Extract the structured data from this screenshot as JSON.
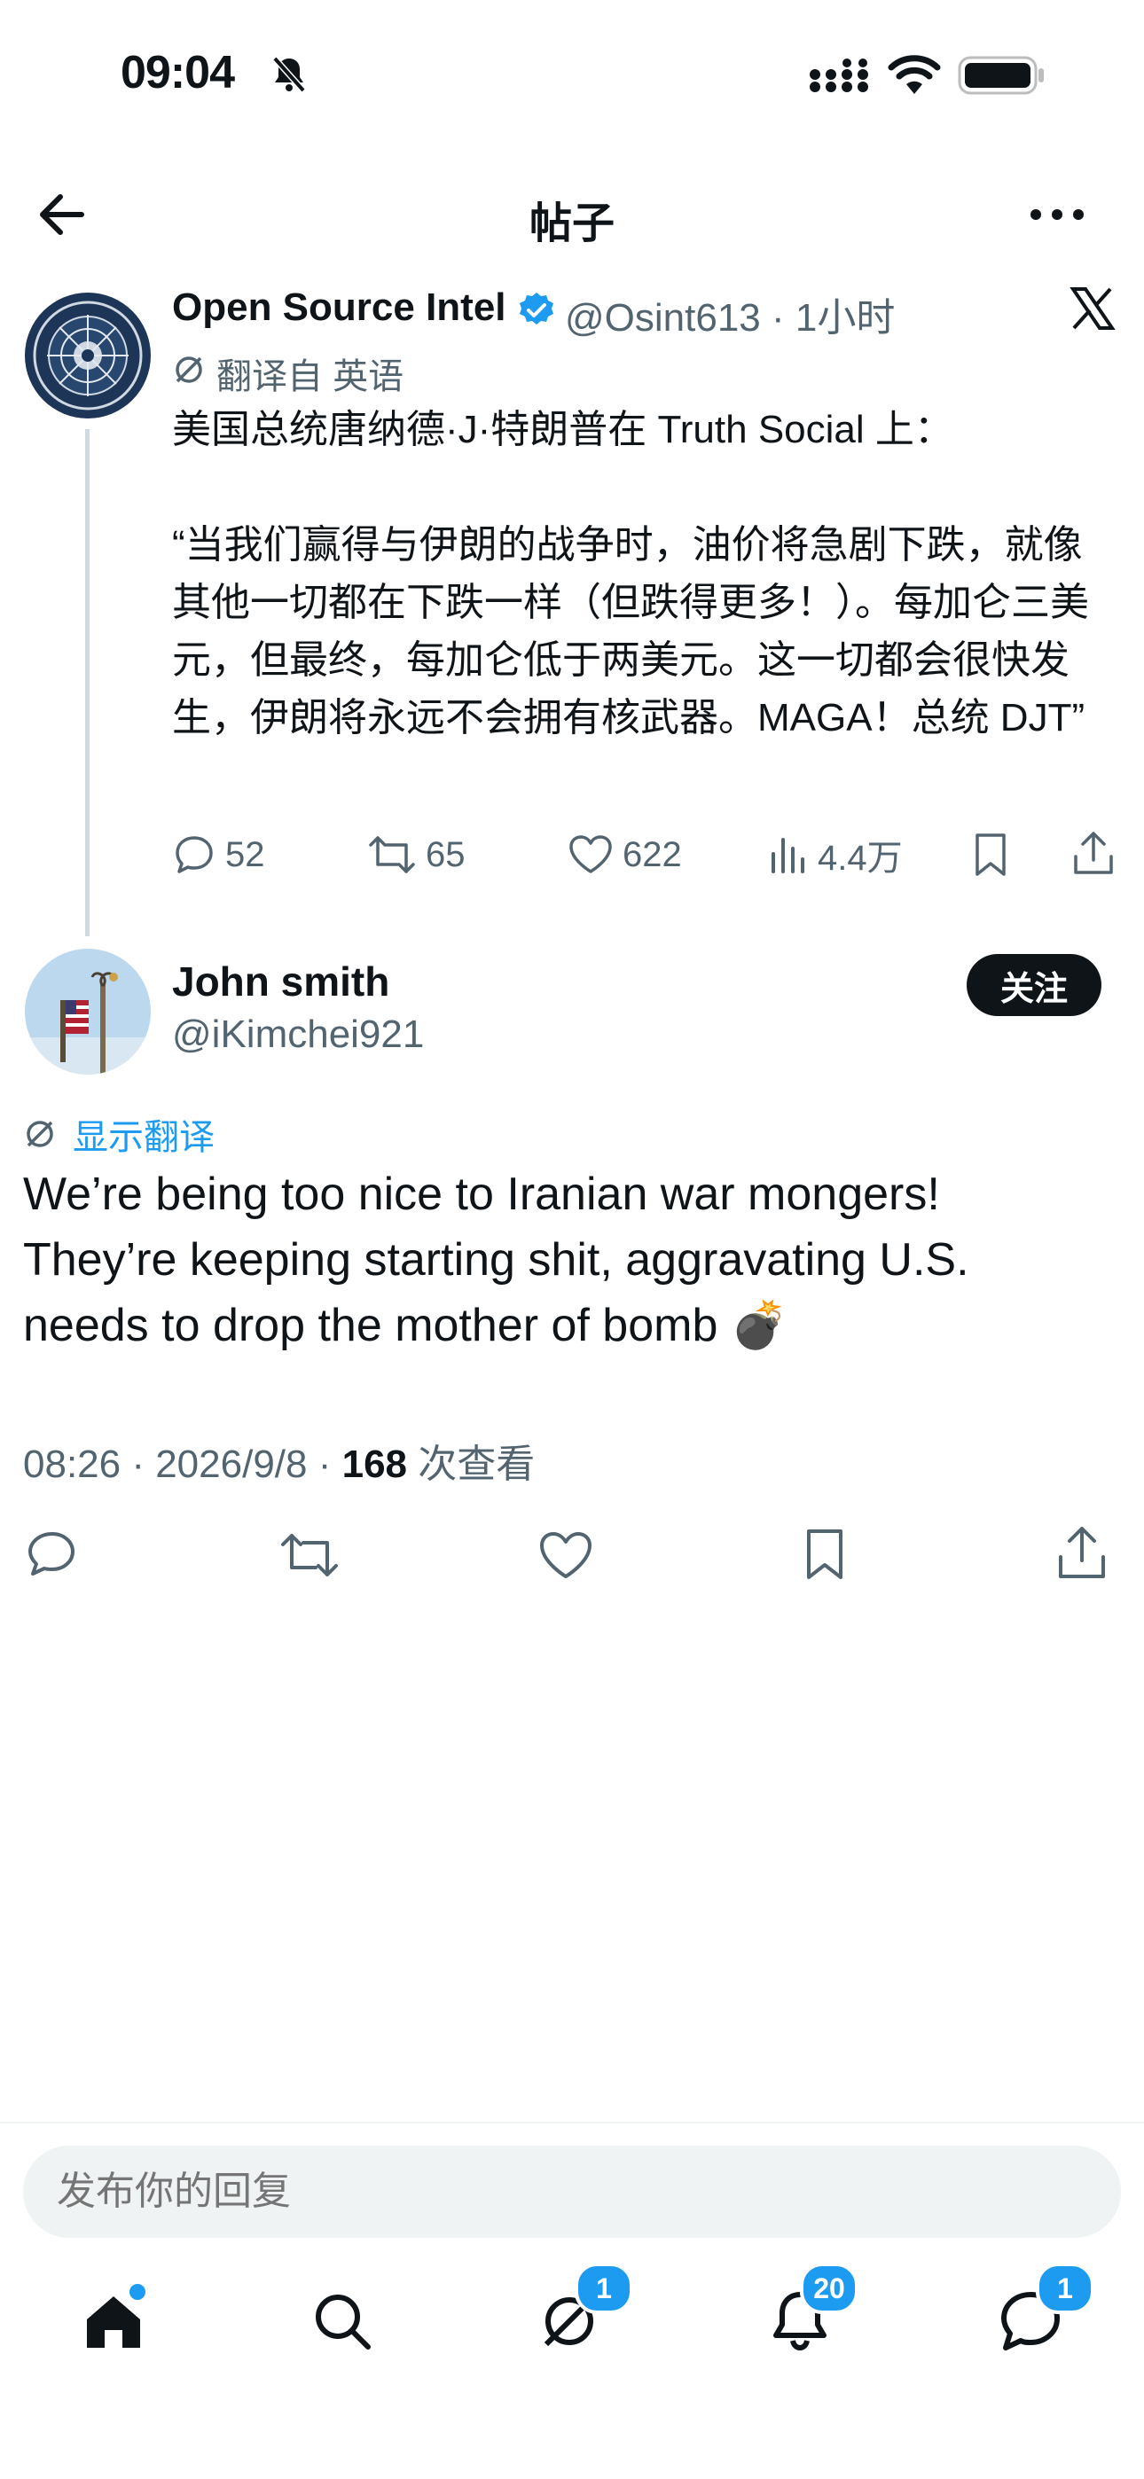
{
  "status_bar": {
    "time": "09:04"
  },
  "header": {
    "title": "帖子"
  },
  "quoted_post": {
    "author_name": "Open Source Intel",
    "handle_time": "@Osint613 · 1小时",
    "translated_from": "翻译自 英语",
    "body": "美国总统唐纳德·J·特朗普在 Truth Social 上：\n\n“当我们赢得与伊朗的战争时，油价将急剧下跌，就像其他一切都在下跌一样（但跌得更多！）。每加仑三美元，但最终，每加仑低于两美元。这一切都会很快发生，伊朗将永远不会拥有核武器。MAGA！总统 DJT”",
    "metrics": {
      "replies": "52",
      "reposts": "65",
      "likes": "622",
      "views": "4.4万"
    }
  },
  "reply_post": {
    "author_name": "John smith",
    "handle": "@iKimchei921",
    "follow_label": "关注",
    "show_translation": "显示翻译",
    "body": "We’re being too nice to Iranian war mongers! They’re keeping starting shit, aggravating U.S. needs to drop the mother of bomb 💣",
    "timestamp": "08:26 · 2026/9/8 · ",
    "view_count": "168",
    "view_label": " 次查看"
  },
  "composer": {
    "placeholder": "发布你的回复"
  },
  "tab_bar": {
    "badges": {
      "grok": "1",
      "notifications": "20",
      "messages": "1"
    }
  },
  "colors": {
    "accent": "#1d9bf0",
    "text": "#0f1419",
    "muted": "#536471"
  }
}
